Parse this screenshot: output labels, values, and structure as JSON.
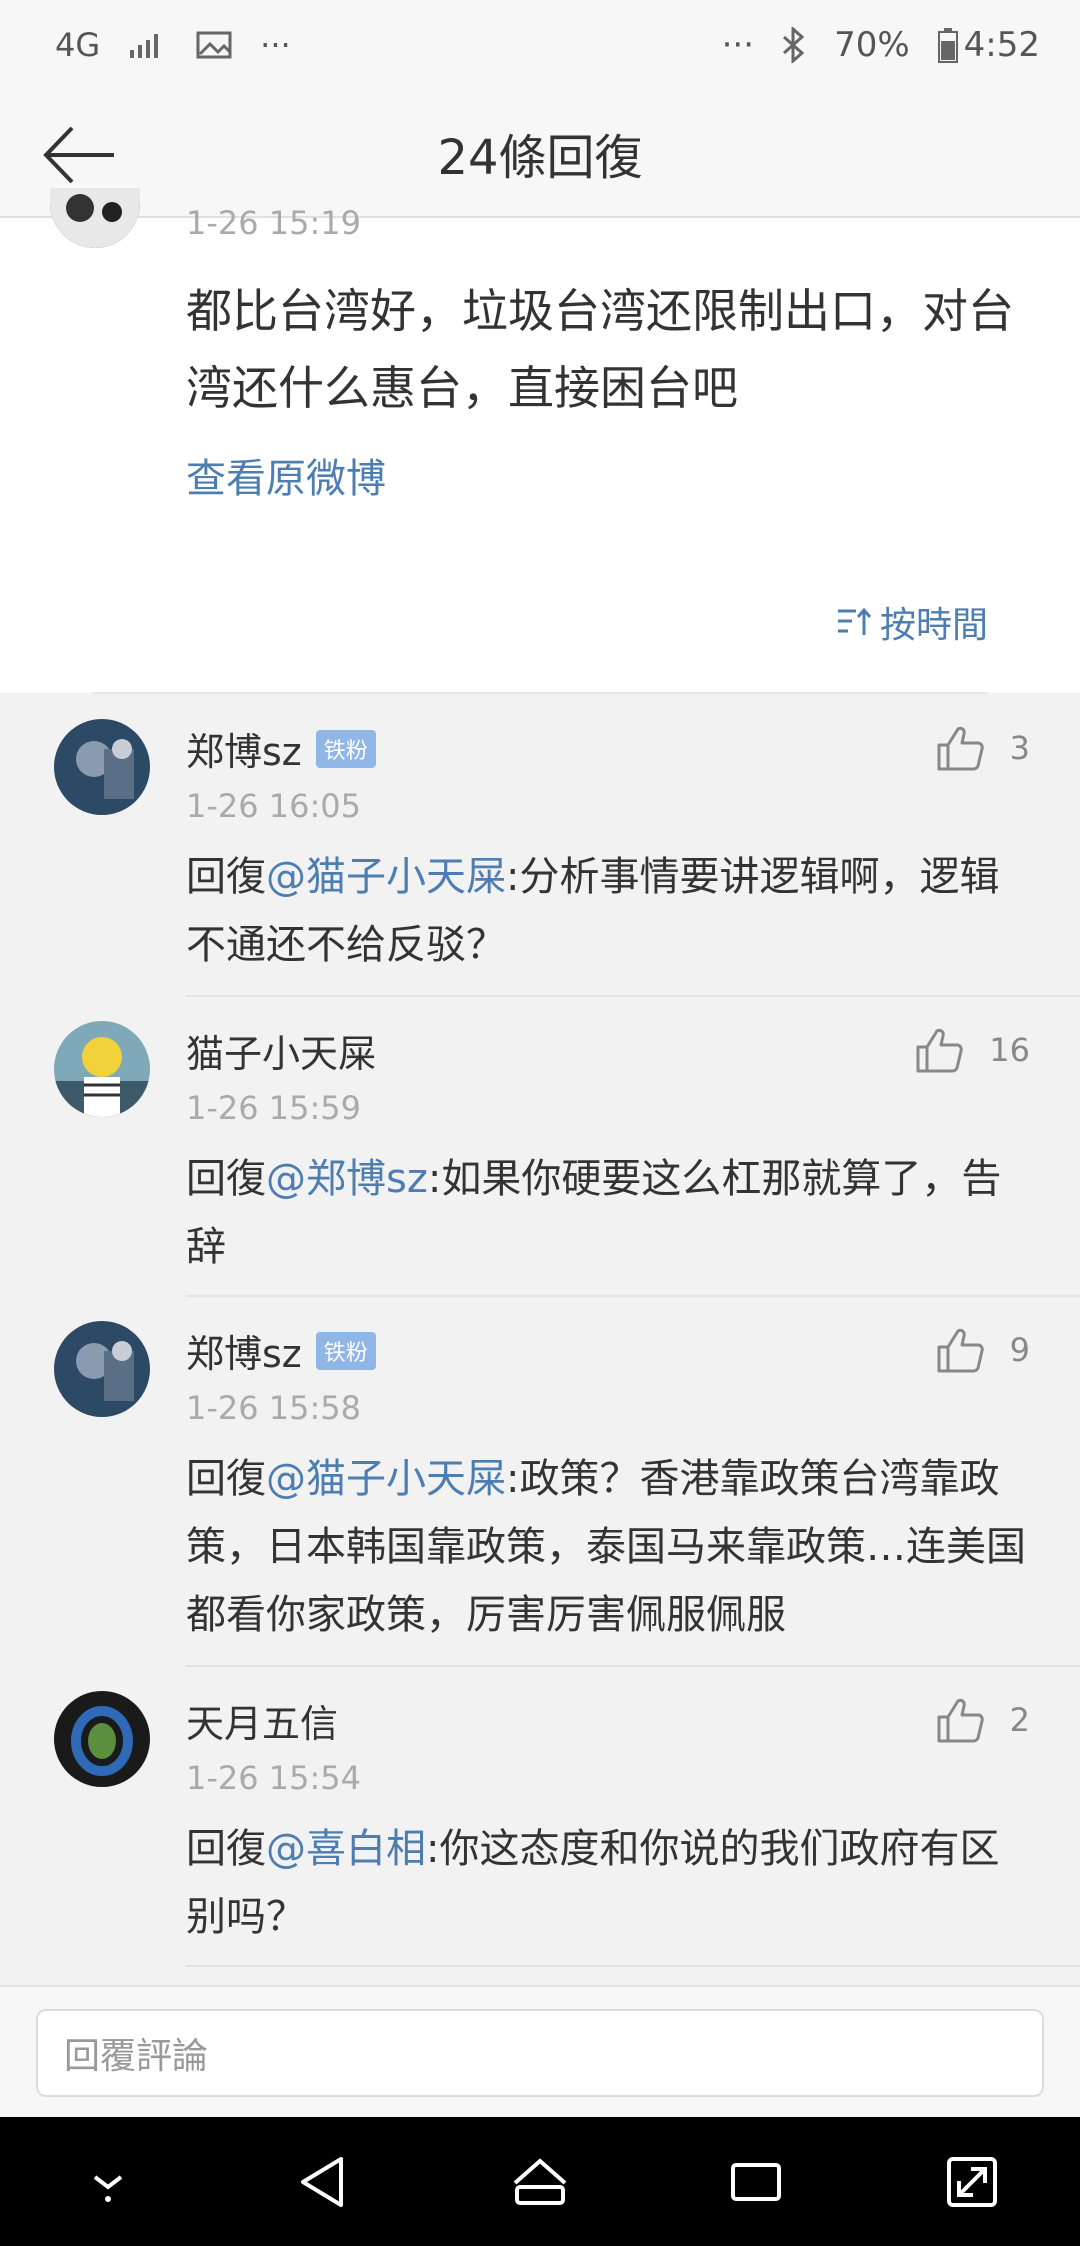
{
  "status_bar": {
    "network": "4G",
    "battery": "70%",
    "time": "4:52"
  },
  "header": {
    "title": "24條回復"
  },
  "post": {
    "time": "1-26 15:19",
    "text": "都比台湾好，垃圾台湾还限制出口，对台湾还什么惠台，直接困台吧",
    "view_original": "查看原微博",
    "sort_label": "按時間"
  },
  "comments": [
    {
      "user": "郑博sz",
      "badge": "铁粉",
      "time": "1-26 16:05",
      "reply_prefix": "回復",
      "mention": "@猫子小天屎",
      "text": ":分析事情要讲逻辑啊，逻辑不通还不给反驳？",
      "likes": "3"
    },
    {
      "user": "猫子小天屎",
      "badge": "",
      "time": "1-26 15:59",
      "reply_prefix": "回復",
      "mention": "@郑博sz",
      "text": ":如果你硬要这么杠那就算了，告辞",
      "likes": "16"
    },
    {
      "user": "郑博sz",
      "badge": "铁粉",
      "time": "1-26 15:58",
      "reply_prefix": "回復",
      "mention": "@猫子小天屎",
      "text": ":政策？香港靠政策台湾靠政策，日本韩国靠政策，泰国马来靠政策…连美国都看你家政策，厉害厉害佩服佩服",
      "likes": "9"
    },
    {
      "user": "天月五信",
      "badge": "",
      "time": "1-26 15:54",
      "reply_prefix": "回復",
      "mention": "@喜白相",
      "text": ":你这态度和你说的我们政府有区别吗？",
      "likes": "2"
    }
  ],
  "reply_bar": {
    "placeholder": "回覆評論"
  },
  "colors": {
    "link": "#4d7db1",
    "badge": "#8fb6e6"
  }
}
